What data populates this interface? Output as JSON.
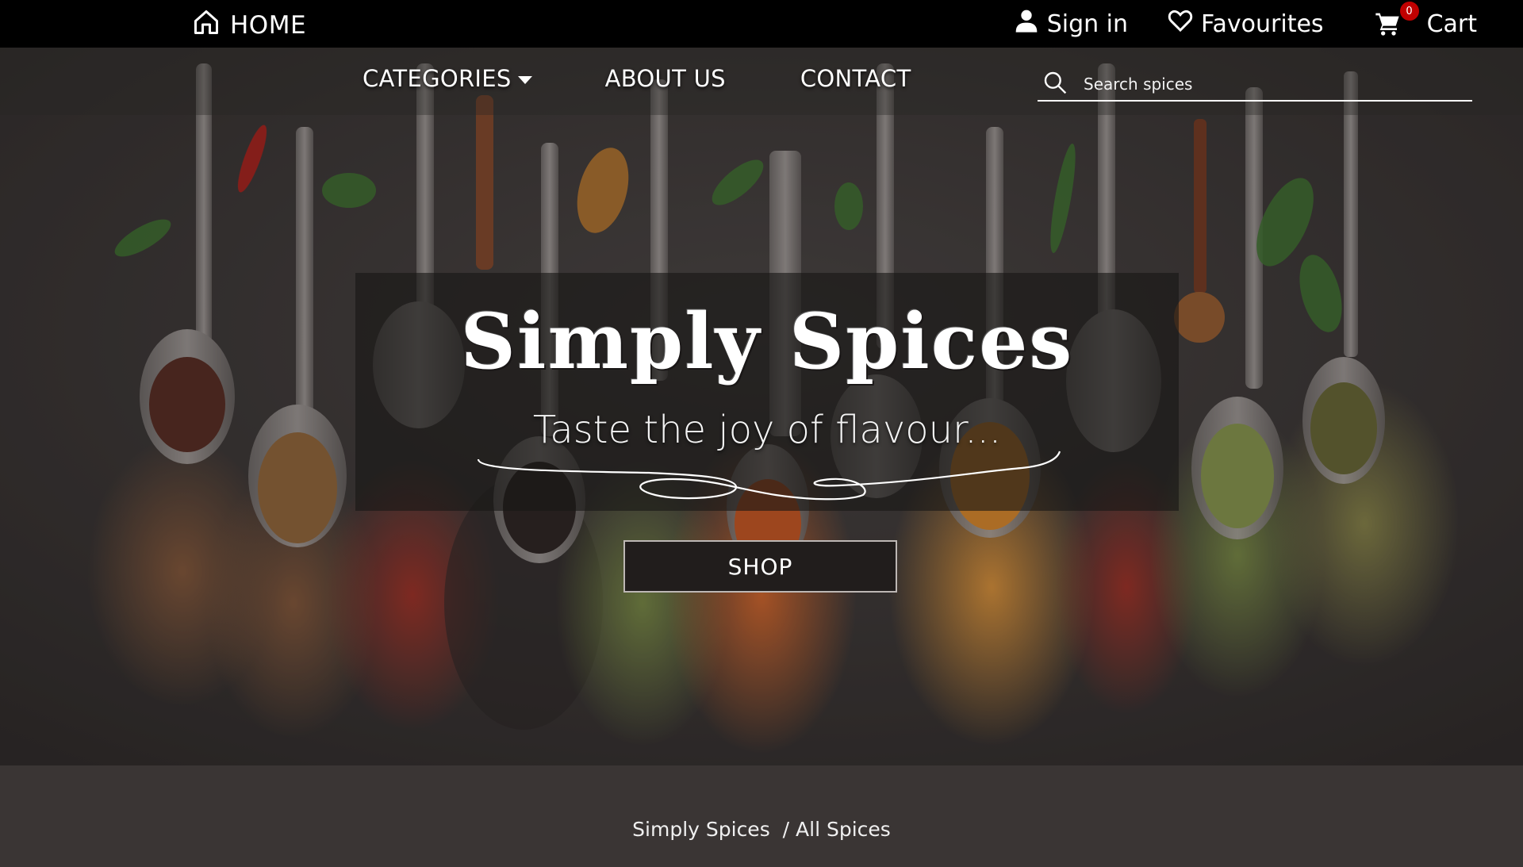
{
  "topbar": {
    "home_label": "HOME",
    "signin_label": "Sign in",
    "favourites_label": "Favourites",
    "cart_label": "Cart",
    "cart_count": "0"
  },
  "nav": {
    "categories_label": "CATEGORIES",
    "about_label": "ABOUT US",
    "contact_label": "CONTACT"
  },
  "search": {
    "placeholder": "Search spices"
  },
  "hero": {
    "title": "Simply Spices",
    "tagline": "Taste the joy of flavour...",
    "shop_label": "SHOP"
  },
  "breadcrumb": {
    "root": "Simply Spices",
    "current": "/ All Spices"
  },
  "icons": {
    "home": "home-icon",
    "user": "user-icon",
    "heart": "heart-icon",
    "cart": "cart-icon",
    "search": "search-icon",
    "caret": "caret-down-icon"
  },
  "colors": {
    "topbar_bg": "#000000",
    "badge": "#c00000",
    "page_bg": "#3a3534"
  }
}
